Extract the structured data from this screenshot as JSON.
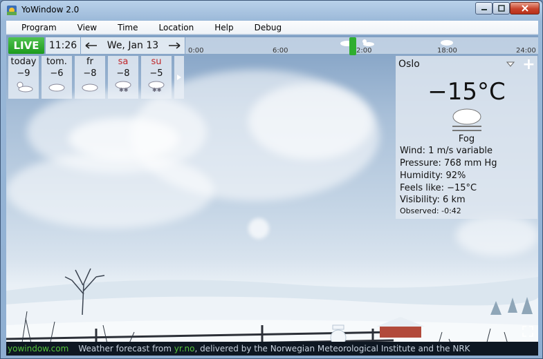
{
  "window": {
    "title": "YoWindow 2.0"
  },
  "menu": [
    "Program",
    "View",
    "Time",
    "Location",
    "Help",
    "Debug"
  ],
  "topbar": {
    "live_label": "LIVE",
    "time": "11:26",
    "date": "We, Jan 13",
    "timeline_ticks": [
      "0:00",
      "6:00",
      "2:00",
      "18:00",
      "24:00"
    ]
  },
  "forecast": [
    {
      "day": "today",
      "temp": "−9",
      "icon": "sun-cloud-icon",
      "weekend": false
    },
    {
      "day": "tom.",
      "temp": "−6",
      "icon": "cloud-icon",
      "weekend": false
    },
    {
      "day": "fr",
      "temp": "−8",
      "icon": "cloud-icon",
      "weekend": false
    },
    {
      "day": "sa",
      "temp": "−8",
      "icon": "snow-cloud-icon",
      "weekend": true
    },
    {
      "day": "su",
      "temp": "−5",
      "icon": "snow-cloud-icon",
      "weekend": true
    }
  ],
  "info": {
    "city": "Oslo",
    "temperature": "−15°C",
    "condition": "Fog",
    "wind": "Wind:  1 m/s variable",
    "pressure": "Pressure:  768 mm Hg",
    "humidity": "Humidity:  92%",
    "feels_like": "Feels like:  −15°C",
    "visibility": "Visibility:  6 km",
    "observed": "Observed:  -0:42"
  },
  "status": {
    "site": "yowindow.com",
    "msg_prefix": "Weather forecast from ",
    "msg_link": "yr.no",
    "msg_suffix": ", delivered by the Norwegian Meteorological Institute and the NRK"
  },
  "colors": {
    "live_green": "#1d9a1d",
    "weekend_red": "#c0282b",
    "status_green": "#55c43a"
  }
}
